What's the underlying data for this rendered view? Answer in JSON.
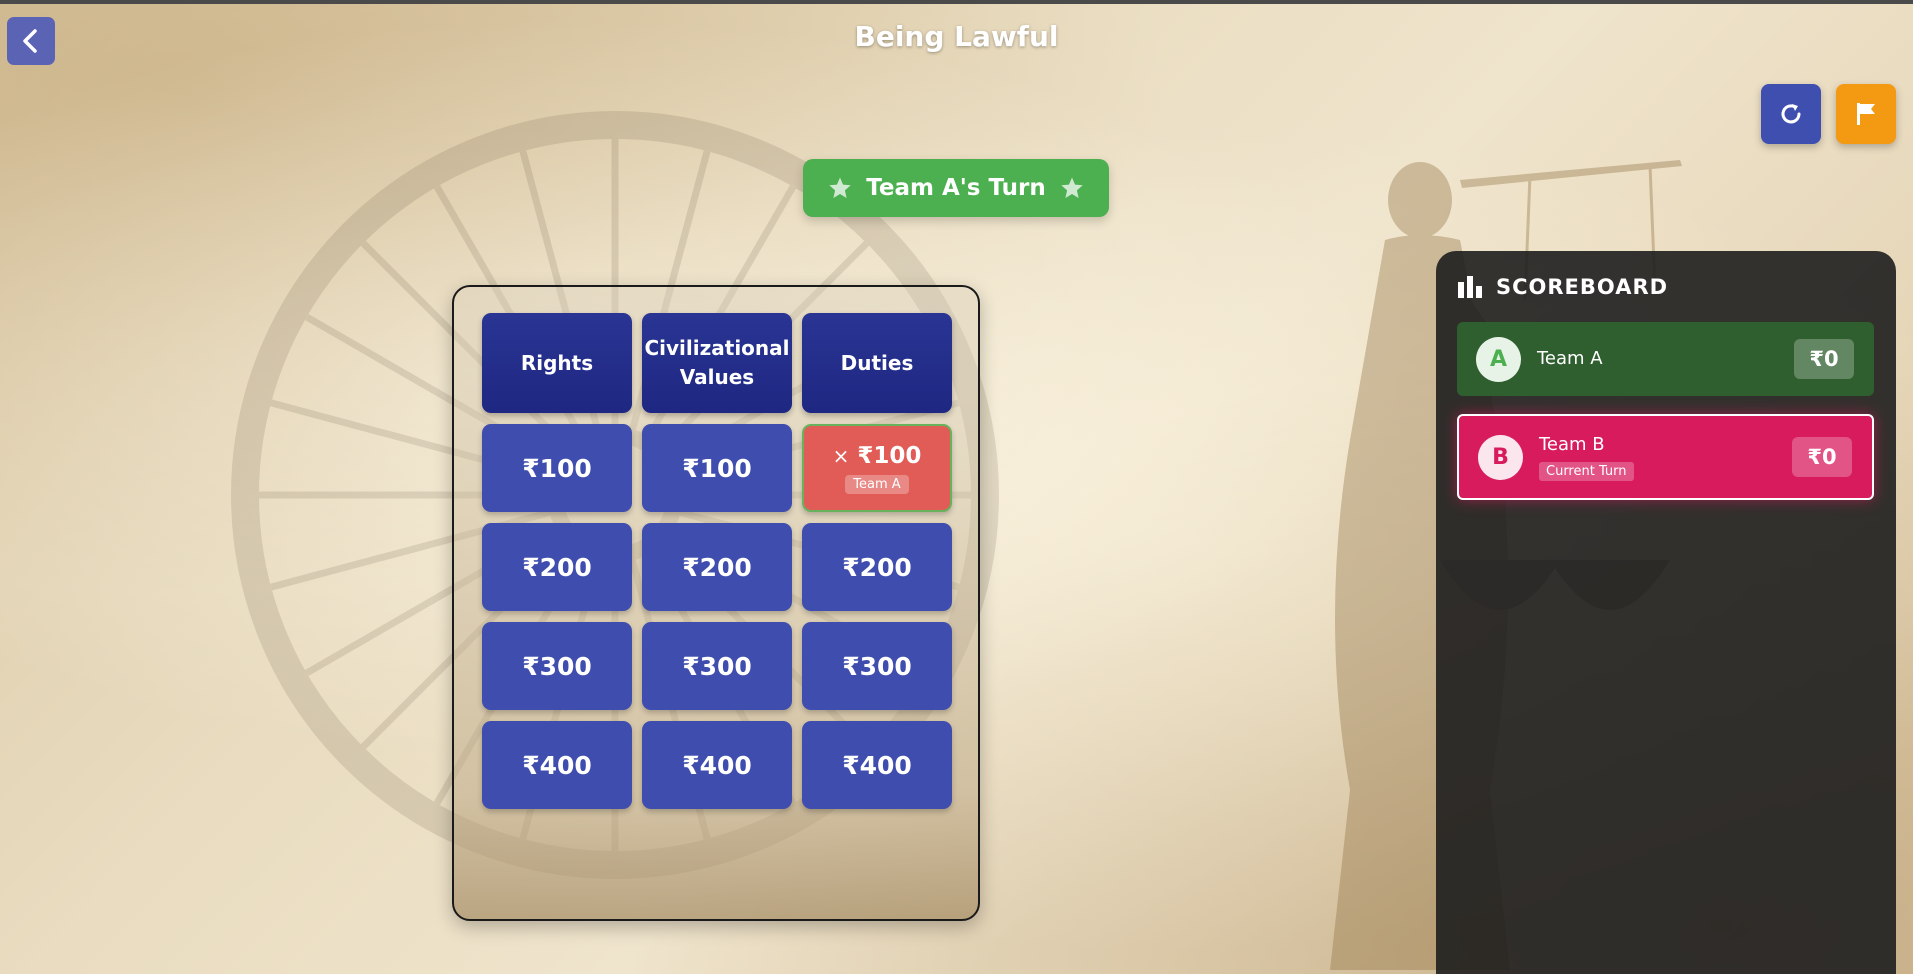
{
  "title": "Being Lawful",
  "turn_banner": {
    "text": "Team A's Turn"
  },
  "icons": {
    "back": "chevron-left-icon",
    "refresh": "refresh-icon",
    "flag": "flag-icon",
    "star": "star-icon",
    "scoreboard": "bar-chart-icon"
  },
  "colors": {
    "team_a": "#4caf50",
    "team_b": "#d81b5d",
    "category": "#232d8a",
    "cell": "#3f4eae",
    "answered_wrong": "#e15c57",
    "refresh_button": "#3f4fb0",
    "flag_button": "#f39a12"
  },
  "board": {
    "categories": [
      "Rights",
      "Civilizational Values",
      "Duties"
    ],
    "rows": [
      [
        "₹100",
        "₹100",
        "₹100"
      ],
      [
        "₹200",
        "₹200",
        "₹200"
      ],
      [
        "₹300",
        "₹300",
        "₹300"
      ],
      [
        "₹400",
        "₹400",
        "₹400"
      ]
    ],
    "answered": {
      "mark": "×",
      "value": "₹100",
      "team": "Team A",
      "result": "wrong"
    }
  },
  "scoreboard": {
    "title": "SCOREBOARD",
    "teams": [
      {
        "initial": "A",
        "name": "Team A",
        "score": "₹0"
      },
      {
        "initial": "B",
        "name": "Team B",
        "score": "₹0",
        "tag": "Current Turn"
      }
    ]
  }
}
